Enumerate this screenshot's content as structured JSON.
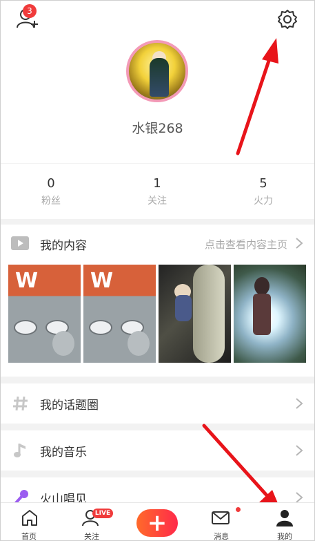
{
  "header": {
    "friend_badge": "3",
    "username": "水银268"
  },
  "stats": [
    {
      "value": "0",
      "label": "粉丝"
    },
    {
      "value": "1",
      "label": "关注"
    },
    {
      "value": "5",
      "label": "火力"
    }
  ],
  "content": {
    "title": "我的内容",
    "link": "点击查看内容主页"
  },
  "rows": [
    {
      "label": "我的话题圈",
      "icon": "hash-icon"
    },
    {
      "label": "我的音乐",
      "icon": "music-note-icon"
    },
    {
      "label": "火山唱见",
      "icon": "microphone-icon"
    }
  ],
  "tabbar": {
    "home": "首页",
    "follow": "关注",
    "live_badge": "LIVE",
    "create": "+",
    "messages": "消息",
    "me": "我的"
  },
  "colors": {
    "accent": "#f03b3b",
    "arrow": "#e8141a",
    "create_gradient_start": "#ff6a2a",
    "create_gradient_end": "#ff2a4a"
  }
}
